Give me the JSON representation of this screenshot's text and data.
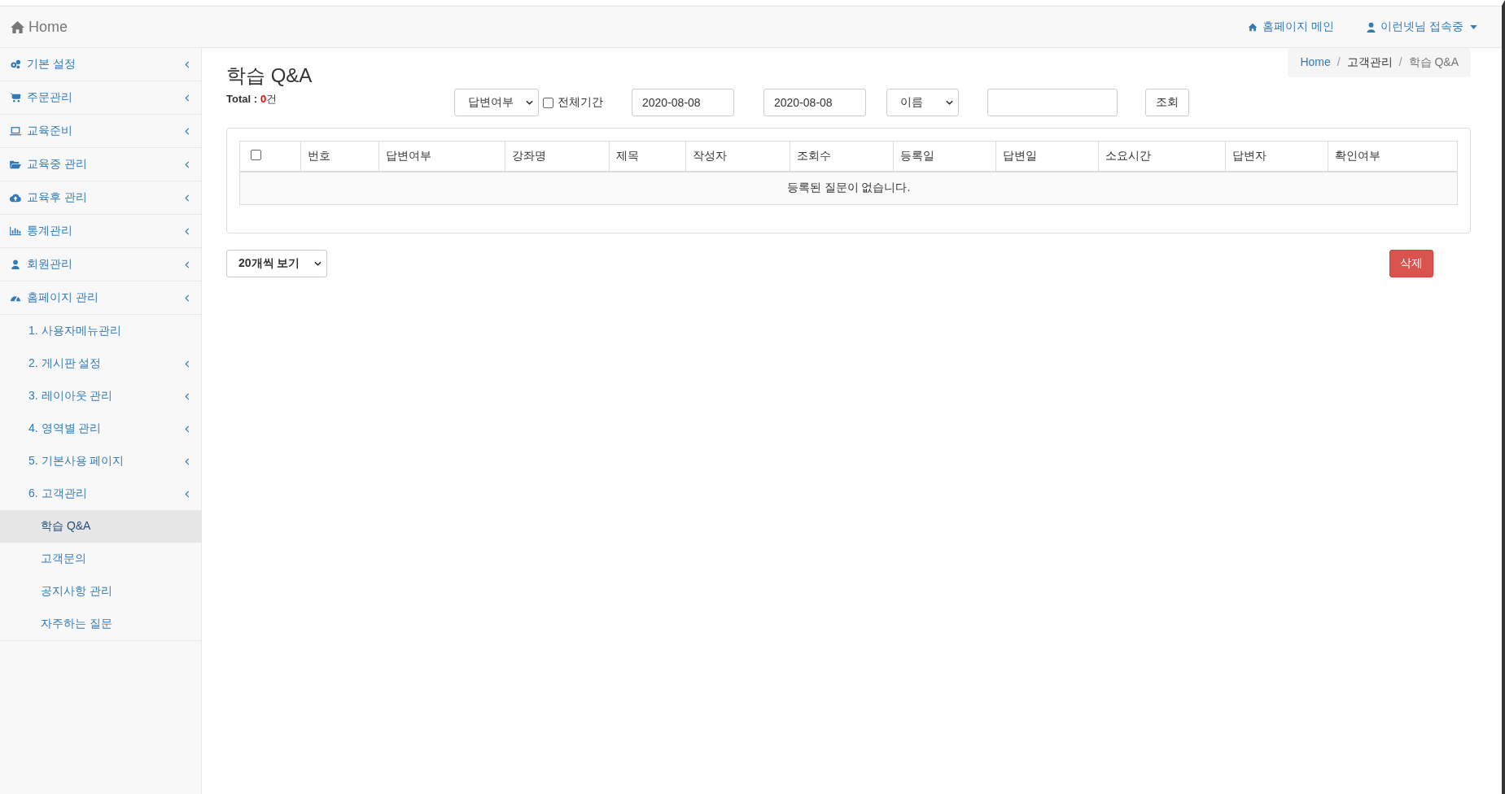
{
  "navbar": {
    "brand": "Home",
    "links": [
      {
        "kind": "home",
        "label": "홈페이지 메인"
      },
      {
        "kind": "user",
        "label": "이런넷님 접속중"
      }
    ]
  },
  "sidebar": {
    "items": [
      {
        "label": "기본 설정",
        "arrow": true,
        "selected": false
      },
      {
        "label": "주문관리",
        "arrow": true,
        "selected": false
      },
      {
        "label": "교육준비",
        "arrow": true,
        "selected": false
      },
      {
        "label": "교육중 관리",
        "arrow": true,
        "selected": false
      },
      {
        "label": "교육후 관리",
        "arrow": true,
        "selected": false
      },
      {
        "label": "통계관리",
        "arrow": true,
        "selected": false
      },
      {
        "label": "회원관리",
        "arrow": true,
        "selected": false
      },
      {
        "label": "홈페이지 관리",
        "arrow": true,
        "selected": false,
        "children": [
          {
            "label": "1. 사용자메뉴관리",
            "arrow": false,
            "selected": false
          },
          {
            "label": "2. 게시판 설정",
            "arrow": true,
            "selected": false
          },
          {
            "label": "3. 레이아웃 관리",
            "arrow": true,
            "selected": false
          },
          {
            "label": "4. 영역별 관리",
            "arrow": true,
            "selected": false
          },
          {
            "label": "5. 기본사용 페이지",
            "arrow": true,
            "selected": false
          },
          {
            "label": "6. 고객관리",
            "arrow": true,
            "selected": false,
            "children": [
              {
                "label": "학습 Q&A",
                "arrow": false,
                "selected": true
              },
              {
                "label": "고객문의",
                "arrow": false,
                "selected": false
              },
              {
                "label": "공지사항 관리",
                "arrow": false,
                "selected": false
              },
              {
                "label": "자주하는 질문",
                "arrow": false,
                "selected": false
              }
            ]
          }
        ]
      }
    ]
  },
  "page": {
    "title": "학습 Q&A",
    "breadcrumb": [
      "Home",
      "고객관리",
      "학습 Q&A"
    ],
    "breadcrumb_separator": "/",
    "total": {
      "label": "Total :",
      "count": "0",
      "unit": "건"
    }
  },
  "filters": {
    "answer_select": "답변여부",
    "all_period": {
      "label": "전체기간",
      "checked": false
    },
    "date_from": "2020-08-08",
    "date_to": "2020-08-08",
    "field_select": "이름",
    "search_button": "조회"
  },
  "table": {
    "select_all_checked": false,
    "columns": [
      "번호",
      "답변여부",
      "강좌명",
      "제목",
      "작성자",
      "조회수",
      "등록일",
      "답변일",
      "소요시간",
      "답변자",
      "확인여부"
    ],
    "empty_message": "등록된 질문이 없습니다."
  },
  "footer": {
    "page_size": "20개씩 보기",
    "delete_button": "삭제"
  }
}
